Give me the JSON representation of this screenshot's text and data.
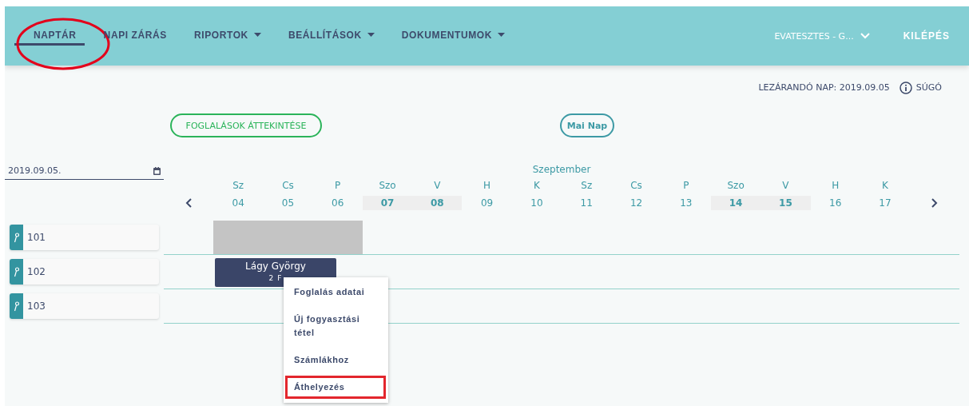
{
  "nav": {
    "items": [
      {
        "label": "NAPTÁR",
        "selected": true,
        "circled": true,
        "dropdown": false
      },
      {
        "label": "NAPI ZÁRÁS",
        "selected": false,
        "circled": false,
        "dropdown": false
      },
      {
        "label": "RIPORTOK",
        "selected": false,
        "circled": false,
        "dropdown": true
      },
      {
        "label": "BEÁLLÍTÁSOK",
        "selected": false,
        "circled": false,
        "dropdown": true
      },
      {
        "label": "DOKUMENTUMOK",
        "selected": false,
        "circled": false,
        "dropdown": true
      }
    ],
    "user": "EVATESZTES - G...",
    "logout": "KILÉPÉS"
  },
  "info_bar": {
    "closing_day": "LEZÁRANDÓ NAP: 2019.09.05",
    "help": "SÚGÓ"
  },
  "buttons": {
    "overview": "FOGLALÁSOK ÁTTEKINTÉSE",
    "today": "Mai Nap"
  },
  "date_field": {
    "value": "2019.09.05."
  },
  "calendar": {
    "month": "Szeptember",
    "days": [
      {
        "weekday": "Sz",
        "date": "04",
        "weekend": false
      },
      {
        "weekday": "Cs",
        "date": "05",
        "weekend": false
      },
      {
        "weekday": "P",
        "date": "06",
        "weekend": false
      },
      {
        "weekday": "Szo",
        "date": "07",
        "weekend": true
      },
      {
        "weekday": "V",
        "date": "08",
        "weekend": true
      },
      {
        "weekday": "H",
        "date": "09",
        "weekend": false
      },
      {
        "weekday": "K",
        "date": "10",
        "weekend": false
      },
      {
        "weekday": "Sz",
        "date": "11",
        "weekend": false
      },
      {
        "weekday": "Cs",
        "date": "12",
        "weekend": false
      },
      {
        "weekday": "P",
        "date": "13",
        "weekend": false
      },
      {
        "weekday": "Szo",
        "date": "14",
        "weekend": true
      },
      {
        "weekday": "V",
        "date": "15",
        "weekend": true
      },
      {
        "weekday": "H",
        "date": "16",
        "weekend": false
      },
      {
        "weekday": "K",
        "date": "17",
        "weekend": false
      }
    ]
  },
  "rooms": [
    {
      "name": "101",
      "blocks": [
        {
          "kind": "blocked"
        }
      ]
    },
    {
      "name": "102",
      "blocks": [
        {
          "kind": "booking",
          "guest": "Lágy György",
          "persons": "2 F"
        }
      ]
    },
    {
      "name": "103"
    }
  ],
  "context_menu": {
    "items": [
      {
        "label": "Foglalás adatai",
        "highlighted": false
      },
      {
        "label": "Új fogyasztási tétel",
        "highlighted": false
      },
      {
        "label": "Számlákhoz",
        "highlighted": false
      },
      {
        "label": "Áthelyezés",
        "highlighted": true
      }
    ]
  }
}
